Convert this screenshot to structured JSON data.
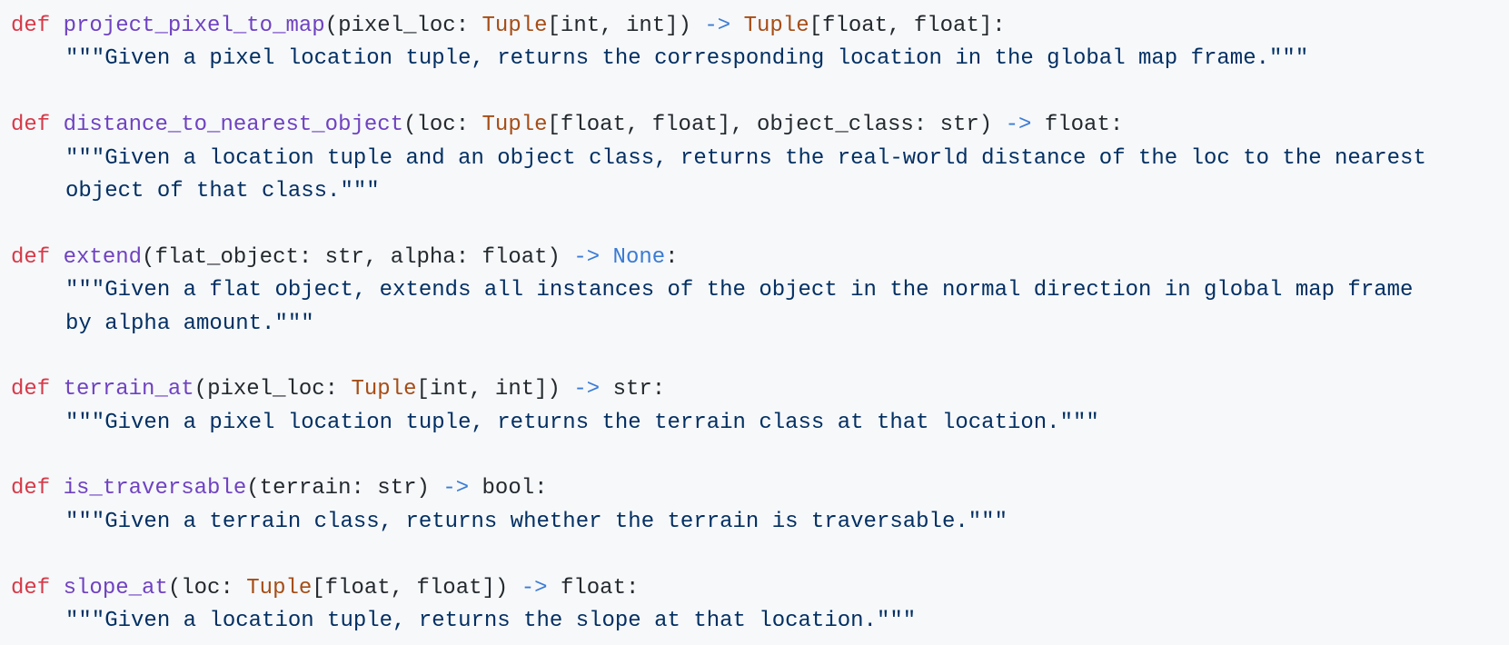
{
  "colors": {
    "keyword": "#d73a49",
    "function_name": "#6f42c1",
    "type": "#a64d16",
    "arrow_operator": "#3b7bd4",
    "constant": "#3b7bd4",
    "docstring": "#032f62",
    "plain": "#24292e",
    "background": "#f6f8fa"
  },
  "functions": [
    {
      "keyword": "def",
      "name": "project_pixel_to_map",
      "open_paren": "(",
      "params_before_type": "pixel_loc: ",
      "param_type": "Tuple",
      "params_after_type": "[int, int])",
      "arrow": "->",
      "return_type": "Tuple",
      "return_after": "[float, float]:",
      "doc_lines": [
        "\"\"\"Given a pixel location tuple, returns the corresponding location in the global map frame.\"\"\""
      ]
    },
    {
      "keyword": "def",
      "name": "distance_to_nearest_object",
      "open_paren": "(",
      "params_before_type": "loc: ",
      "param_type": "Tuple",
      "params_after_type": "[float, float], object_class: str)",
      "arrow": "->",
      "return_plain": "float:",
      "doc_lines": [
        "\"\"\"Given a location tuple and an object class, returns the real-world distance of the loc to the nearest",
        "object of that class.\"\"\""
      ]
    },
    {
      "keyword": "def",
      "name": "extend",
      "params_plain": "(flat_object: str, alpha: float)",
      "arrow": "->",
      "return_constant": "None",
      "colon": ":",
      "doc_lines": [
        "\"\"\"Given a flat object, extends all instances of the object in the normal direction in global map frame",
        "by alpha amount.\"\"\""
      ]
    },
    {
      "keyword": "def",
      "name": "terrain_at",
      "open_paren": "(",
      "params_before_type": "pixel_loc: ",
      "param_type": "Tuple",
      "params_after_type": "[int, int])",
      "arrow": "->",
      "return_plain": "str:",
      "doc_lines": [
        "\"\"\"Given a pixel location tuple, returns the terrain class at that location.\"\"\""
      ]
    },
    {
      "keyword": "def",
      "name": "is_traversable",
      "params_plain": "(terrain: str)",
      "arrow": "->",
      "return_plain": "bool:",
      "doc_lines": [
        "\"\"\"Given a terrain class, returns whether the terrain is traversable.\"\"\""
      ]
    },
    {
      "keyword": "def",
      "name": "slope_at",
      "open_paren": "(",
      "params_before_type": "loc: ",
      "param_type": "Tuple",
      "params_after_type": "[float, float])",
      "arrow": "->",
      "return_plain": "float:",
      "doc_lines": [
        "\"\"\"Given a location tuple, returns the slope at that location.\"\"\""
      ]
    }
  ]
}
